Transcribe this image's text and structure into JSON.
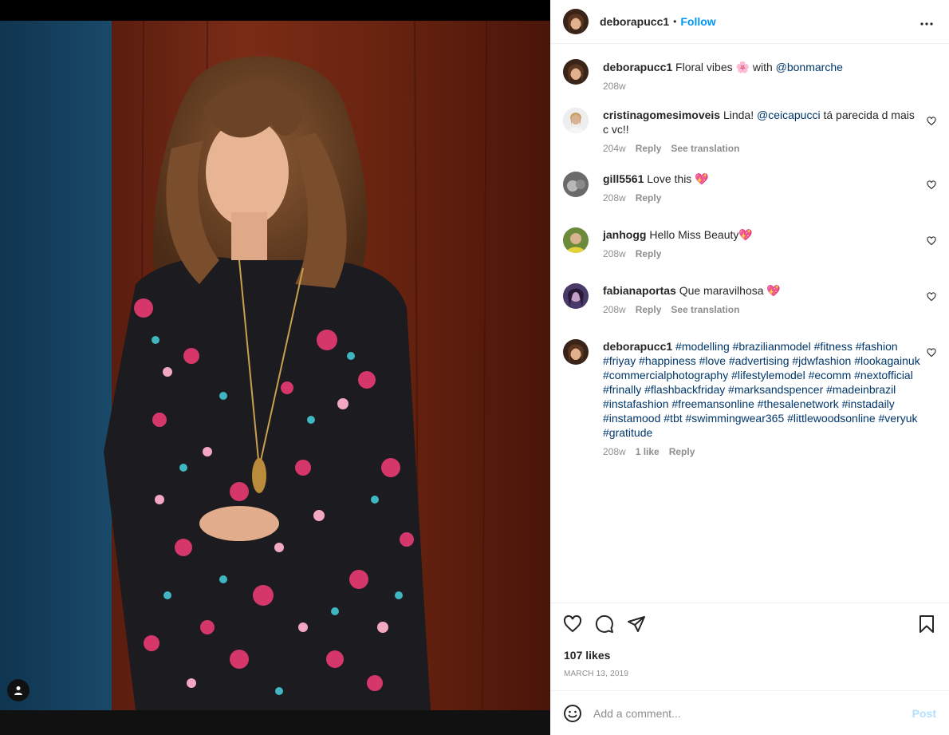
{
  "header": {
    "username": "deborapucc1",
    "separator": "•",
    "follow_label": "Follow"
  },
  "caption": {
    "username": "deborapucc1",
    "text_before": "Floral vibes",
    "emoji": "🌸",
    "text_mid": "with",
    "mention": "@bonmarche",
    "time": "208w"
  },
  "comments": [
    {
      "username": "cristinagomesimoveis",
      "text_before": "Linda!",
      "mention": "@ceicapucci",
      "text_after": "tá parecida d mais c vc!!",
      "time": "204w",
      "reply": "Reply",
      "translate": "See translation"
    },
    {
      "username": "gill5561",
      "text": "Love this",
      "emoji": "💖",
      "time": "208w",
      "reply": "Reply"
    },
    {
      "username": "janhogg",
      "text": "Hello Miss Beauty",
      "emoji": "💖",
      "time": "208w",
      "reply": "Reply"
    },
    {
      "username": "fabianaportas",
      "text": "Que maravilhosa",
      "emoji": "💖",
      "time": "208w",
      "reply": "Reply",
      "translate": "See translation"
    },
    {
      "username": "deborapucc1",
      "hashtags": "#modelling #brazilianmodel #fitness #fashion #friyay #happiness #love #advertising #jdwfashion #lookagainuk #commercialphotography #lifestylemodel #ecomm #nextofficial #frinally #flashbackfriday #marksandspencer #madeinbrazil #instafashion #freemansonline #thesalenetwork #instadaily #instamood #tbt #swimmingwear365 #littlewoodsonline #veryuk #gratitude",
      "time": "208w",
      "likes": "1 like",
      "reply": "Reply"
    }
  ],
  "post": {
    "likes": "107 likes",
    "date": "MARCH 13, 2019"
  },
  "add_comment": {
    "placeholder": "Add a comment...",
    "post_label": "Post"
  },
  "colors": {
    "accent": "#0095f6",
    "link": "#00376b",
    "muted": "#8e8e8e",
    "post_disabled": "#b2dffc"
  },
  "icons": [
    "more-options-icon",
    "heart-icon",
    "comment-icon",
    "share-icon",
    "bookmark-icon",
    "emoji-icon",
    "user-tag-icon"
  ]
}
